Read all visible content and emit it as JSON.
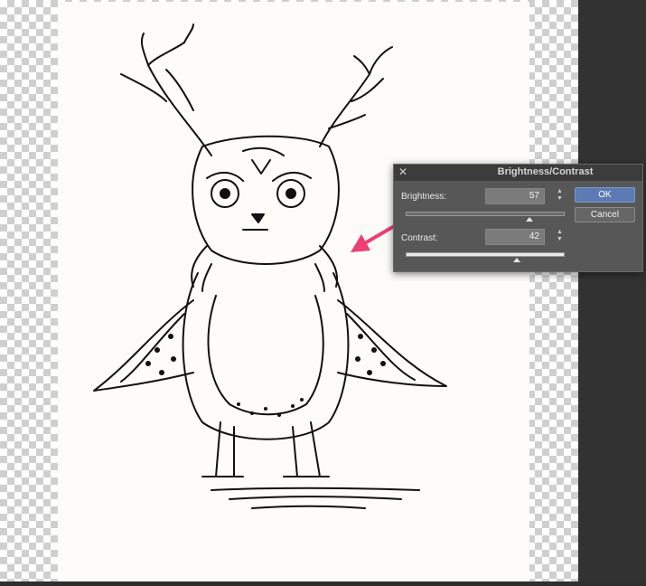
{
  "dialog": {
    "title": "Brightness/Contrast",
    "brightness": {
      "label": "Brightness:",
      "value": "57",
      "fraction": 0.78
    },
    "contrast": {
      "label": "Contrast:",
      "value": "42",
      "fraction": 0.7
    },
    "ok_label": "OK",
    "cancel_label": "Cancel"
  },
  "icons": {
    "close": "close-icon",
    "stepper": "stepper-icon",
    "annotation": "arrow-icon"
  },
  "colors": {
    "canvas_bg": "#2f2f2f",
    "dialog_bg": "#575757",
    "ok_button": "#5c7ab3",
    "annotation_arrow": "#ec3f72"
  }
}
